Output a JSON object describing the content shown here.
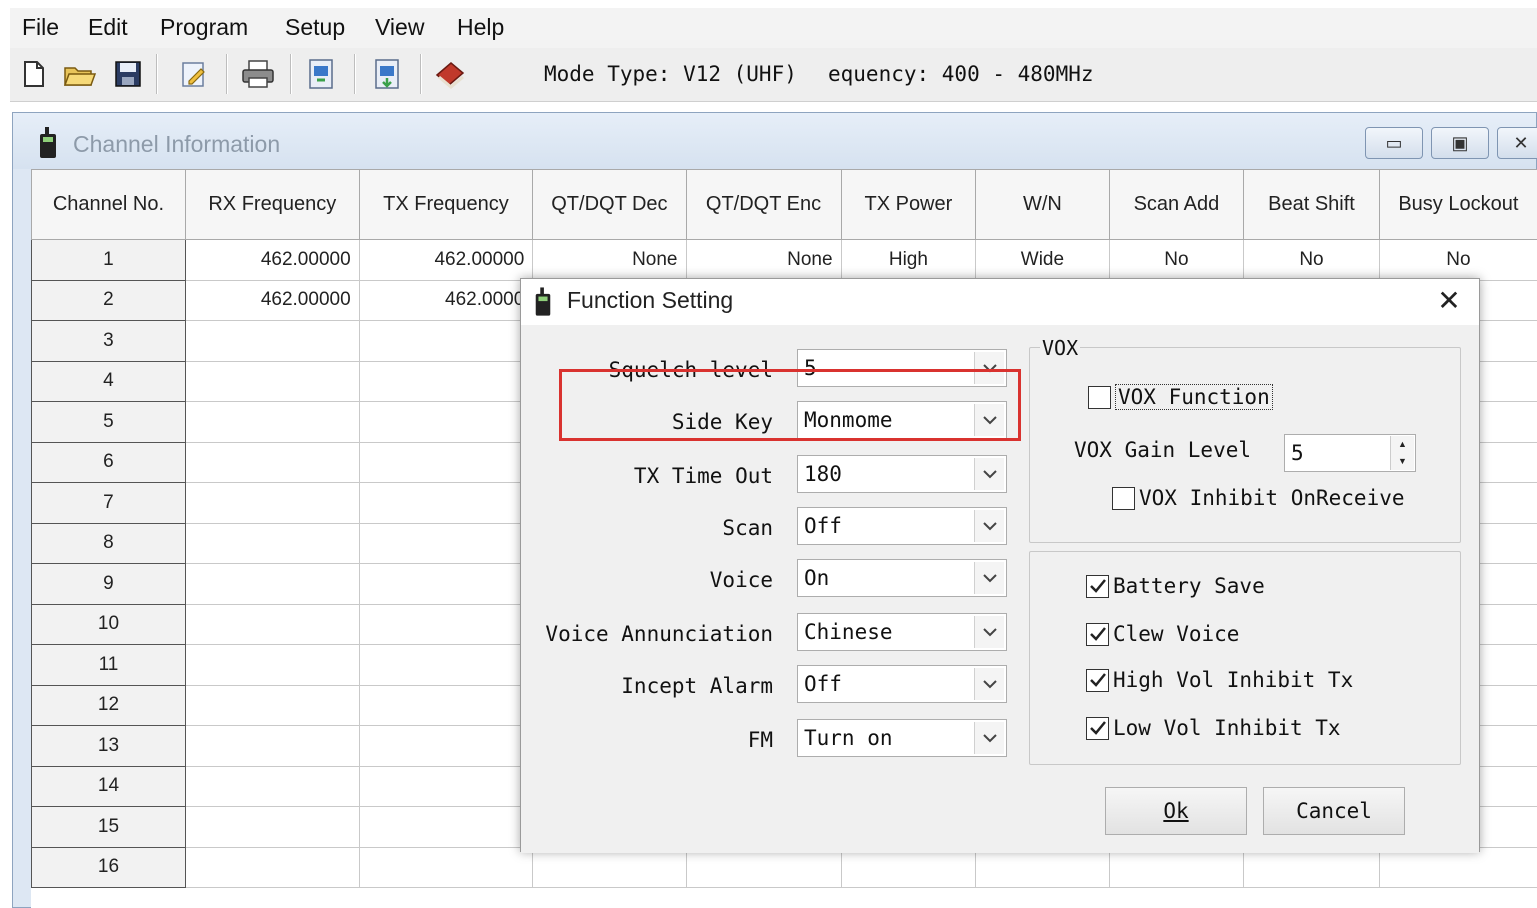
{
  "menu": {
    "file": "File",
    "edit": "Edit",
    "program": "Program",
    "setup": "Setup",
    "view": "View",
    "help": "Help"
  },
  "toolbar": {
    "mode_type": "Mode Type: V12 (UHF)",
    "frequency": "equency:  400 - 480MHz",
    "icons": [
      "new-file-icon",
      "open-folder-icon",
      "save-icon",
      "edit-icon",
      "print-icon",
      "read-from-radio-icon",
      "write-to-radio-icon",
      "info-book-icon"
    ]
  },
  "channel_window": {
    "title": "Channel Information",
    "columns": [
      "Channel No.",
      "RX Frequency",
      "TX Frequency",
      "QT/DQT Dec",
      "QT/DQT Enc",
      "TX Power",
      "W/N",
      "Scan Add",
      "Beat Shift",
      "Busy Lockout"
    ],
    "rows": [
      [
        "1",
        "462.00000",
        "462.00000",
        "None",
        "None",
        "High",
        "Wide",
        "No",
        "No",
        "No"
      ],
      [
        "2",
        "462.00000",
        "462.0000",
        "",
        "",
        "",
        "",
        "",
        "",
        "o"
      ],
      [
        "3",
        "",
        "",
        "",
        "",
        "",
        "",
        "",
        "",
        ""
      ],
      [
        "4",
        "",
        "",
        "",
        "",
        "",
        "",
        "",
        "",
        ""
      ],
      [
        "5",
        "",
        "",
        "",
        "",
        "",
        "",
        "",
        "",
        ""
      ],
      [
        "6",
        "",
        "",
        "",
        "",
        "",
        "",
        "",
        "",
        ""
      ],
      [
        "7",
        "",
        "",
        "",
        "",
        "",
        "",
        "",
        "",
        ""
      ],
      [
        "8",
        "",
        "",
        "",
        "",
        "",
        "",
        "",
        "",
        ""
      ],
      [
        "9",
        "",
        "",
        "",
        "",
        "",
        "",
        "",
        "",
        ""
      ],
      [
        "10",
        "",
        "",
        "",
        "",
        "",
        "",
        "",
        "",
        ""
      ],
      [
        "11",
        "",
        "",
        "",
        "",
        "",
        "",
        "",
        "",
        ""
      ],
      [
        "12",
        "",
        "",
        "",
        "",
        "",
        "",
        "",
        "",
        ""
      ],
      [
        "13",
        "",
        "",
        "",
        "",
        "",
        "",
        "",
        "",
        ""
      ],
      [
        "14",
        "",
        "",
        "",
        "",
        "",
        "",
        "",
        "",
        ""
      ],
      [
        "15",
        "",
        "",
        "",
        "",
        "",
        "",
        "",
        "",
        ""
      ],
      [
        "16",
        "",
        "",
        "",
        "",
        "",
        "",
        "",
        "",
        ""
      ]
    ]
  },
  "dialog": {
    "title": "Function Setting",
    "close": "✕",
    "fields": [
      {
        "label": "Squelch level",
        "value": "5"
      },
      {
        "label": "Side Key",
        "value": "Monmome"
      },
      {
        "label": "TX Time Out",
        "value": "180"
      },
      {
        "label": "Scan",
        "value": "Off"
      },
      {
        "label": "Voice",
        "value": "On"
      },
      {
        "label": "Voice Annunciation",
        "value": "Chinese"
      },
      {
        "label": "Incept Alarm",
        "value": "Off"
      },
      {
        "label": "FM",
        "value": "Turn on"
      }
    ],
    "vox": {
      "legend": "VOX",
      "function_label": "VOX Function",
      "function_checked": false,
      "gain_label": "VOX Gain Level",
      "gain_value": "5",
      "inhibit_label": "VOX Inhibit OnReceive",
      "inhibit_checked": false
    },
    "options": [
      {
        "label": "Battery Save",
        "checked": true
      },
      {
        "label": "Clew Voice",
        "checked": true
      },
      {
        "label": "High Vol Inhibit Tx",
        "checked": true
      },
      {
        "label": "Low Vol Inhibit Tx",
        "checked": true
      }
    ],
    "ok_label": "Ok",
    "cancel_label": "Cancel"
  },
  "colors": {
    "highlight": "#d9322f",
    "window_frame": "#dde7f3"
  }
}
